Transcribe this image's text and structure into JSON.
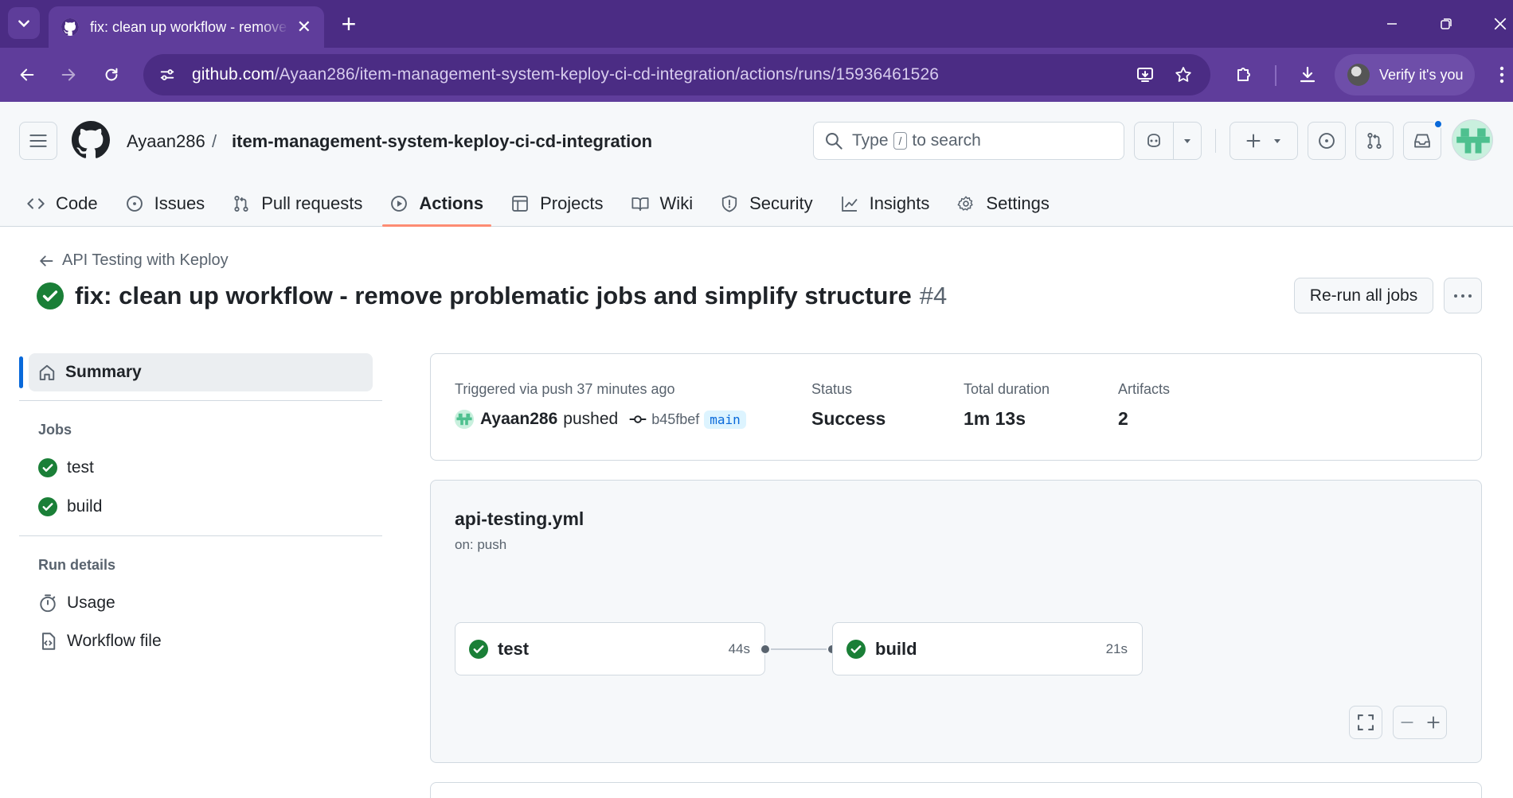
{
  "browser": {
    "tab_title": "fix: clean up workflow - remove problematic jobs and simplify structure",
    "tab_close": "✕",
    "new_tab": "+",
    "url_host": "github.com",
    "url_path": "/Ayaan286/item-management-system-keploy-ci-cd-integration/actions/runs/15936461526",
    "verify_label": "Verify it's you"
  },
  "header": {
    "owner": "Ayaan286",
    "separator": "/",
    "repo": "item-management-system-keploy-ci-cd-integration",
    "search_prefix": "Type",
    "search_key": "/",
    "search_suffix": "to search"
  },
  "repo_nav": [
    {
      "label": "Code",
      "icon": "code-icon"
    },
    {
      "label": "Issues",
      "icon": "issue-icon"
    },
    {
      "label": "Pull requests",
      "icon": "pull-request-icon"
    },
    {
      "label": "Actions",
      "icon": "actions-icon",
      "active": true
    },
    {
      "label": "Projects",
      "icon": "projects-icon"
    },
    {
      "label": "Wiki",
      "icon": "book-icon"
    },
    {
      "label": "Security",
      "icon": "shield-icon"
    },
    {
      "label": "Insights",
      "icon": "graph-icon"
    },
    {
      "label": "Settings",
      "icon": "gear-icon"
    }
  ],
  "run": {
    "back_label": "API Testing with Keploy",
    "title": "fix: clean up workflow - remove problematic jobs and simplify structure",
    "number": "#4",
    "rerun_label": "Re-run all jobs",
    "status_color": "#1a7f37"
  },
  "sidebar": {
    "summary_label": "Summary",
    "jobs_heading": "Jobs",
    "jobs": [
      {
        "label": "test",
        "status": "success"
      },
      {
        "label": "build",
        "status": "success"
      }
    ],
    "run_details_heading": "Run details",
    "details": [
      {
        "label": "Usage",
        "icon": "stopwatch-icon"
      },
      {
        "label": "Workflow file",
        "icon": "workflow-file-icon"
      }
    ]
  },
  "summary": {
    "trigger_label": "Triggered via push 37 minutes ago",
    "user": "Ayaan286",
    "action": "pushed",
    "commit": "b45fbef",
    "branch": "main",
    "status_label": "Status",
    "status_value": "Success",
    "duration_label": "Total duration",
    "duration_value": "1m 13s",
    "artifacts_label": "Artifacts",
    "artifacts_value": "2"
  },
  "workflow": {
    "file": "api-testing.yml",
    "trigger": "on: push",
    "jobs": [
      {
        "name": "test",
        "duration": "44s"
      },
      {
        "name": "build",
        "duration": "21s"
      }
    ]
  },
  "colors": {
    "accent": "#0969da",
    "success": "#1a7f37",
    "tab_underline": "#fd8c73",
    "browser_frame": "#4b2c84"
  }
}
